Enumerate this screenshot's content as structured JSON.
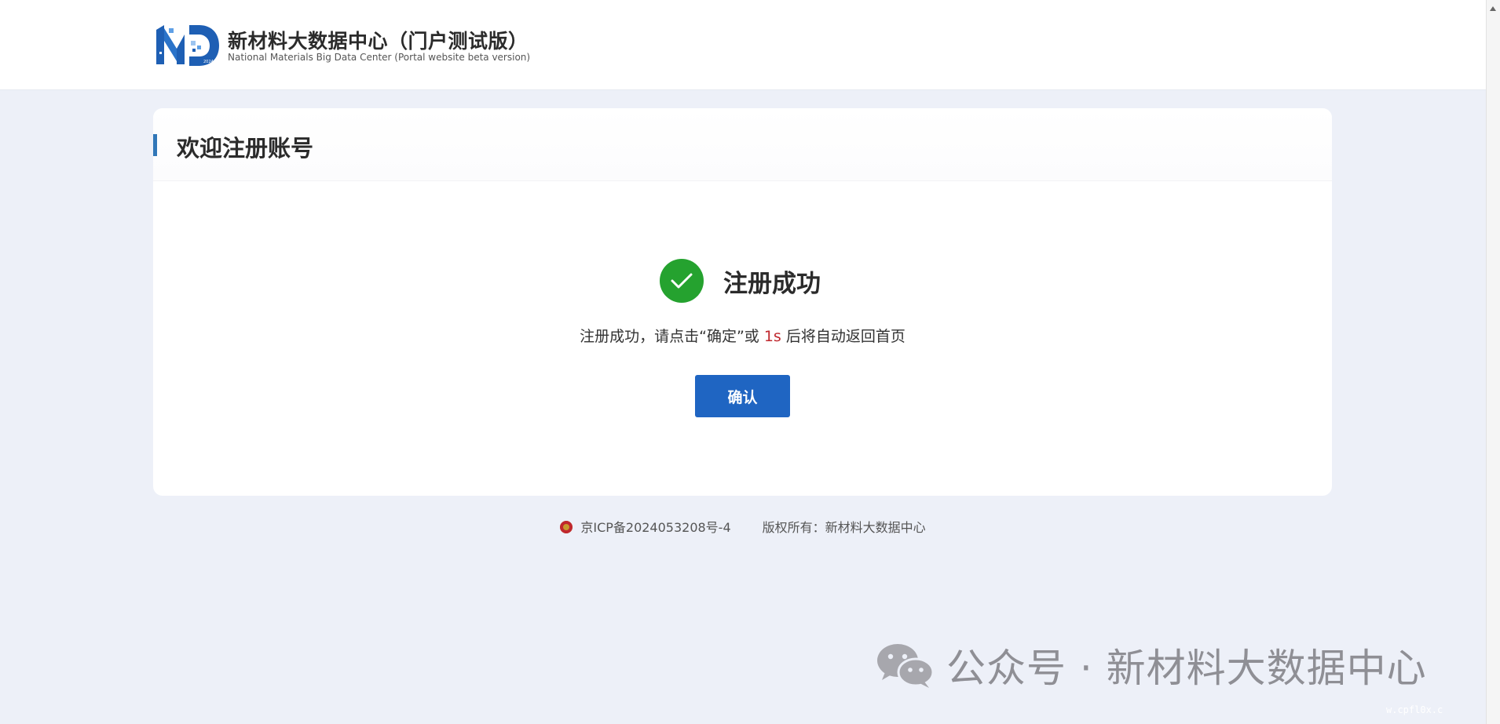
{
  "header": {
    "brand_title": "新材料大数据中心（门户测试版）",
    "brand_subtitle": "National Materials Big Data Center (Portal website beta version)",
    "logo_text": "2024"
  },
  "card": {
    "title": "欢迎注册账号",
    "success_title": "注册成功",
    "message_prefix": "注册成功，请点击“确定”或 ",
    "countdown": "1s",
    "message_suffix": " 后将自动返回首页",
    "confirm_label": "确认"
  },
  "footer": {
    "icp": "京ICP备2024053208号-4",
    "copyright": "版权所有：新材料大数据中心"
  },
  "watermark": {
    "text": "公众号 · 新材料大数据中心",
    "corner": "w.cpfl0x.c"
  },
  "colors": {
    "page_bg": "#edf0f8",
    "accent": "#3177b8",
    "button": "#1f65c2",
    "success": "#25a22f",
    "countdown": "#c0282e"
  },
  "icons": {
    "logo": "nmbdc-logo-icon",
    "success": "check-circle-icon",
    "footer": "national-emblem-icon",
    "watermark": "wechat-icon"
  }
}
